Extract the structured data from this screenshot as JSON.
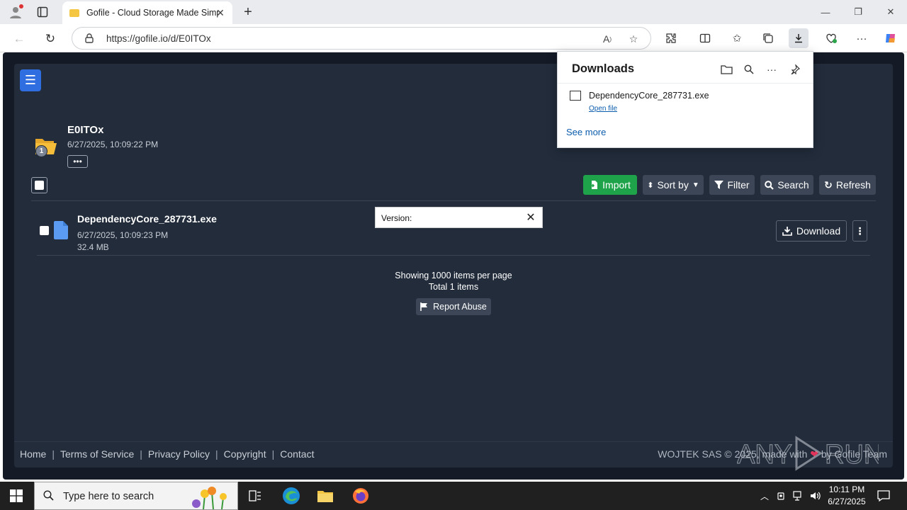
{
  "browser": {
    "tab_title": "Gofile - Cloud Storage Made Simple",
    "url": "https://gofile.io/d/E0ITOx"
  },
  "page": {
    "folder": {
      "name": "E0ITOx",
      "date": "6/27/2025, 10:09:22 PM",
      "badge_count": "1",
      "more_label": "•••"
    },
    "toolbar": {
      "import": "Import",
      "sort_by": "Sort by",
      "filter": "Filter",
      "search": "Search",
      "refresh": "Refresh"
    },
    "file": {
      "name": "DependencyCore_287731.exe",
      "date": "6/27/2025, 10:09:23 PM",
      "size": "32.4 MB",
      "download_label": "Download"
    },
    "version_popup": {
      "label": "Version:"
    },
    "pager": {
      "per_page": "Showing 1000 items per page",
      "total": "Total 1 items"
    },
    "report_abuse": "Report Abuse",
    "footer": {
      "links": [
        "Home",
        "Terms of Service",
        "Privacy Policy",
        "Copyright",
        "Contact"
      ],
      "copyright_pre": "WOJTEK SAS © 2025, made with",
      "copyright_post": "by Gofile Team"
    }
  },
  "downloads_panel": {
    "title": "Downloads",
    "file_name": "DependencyCore_287731.exe",
    "open_file": "Open file",
    "see_more": "See more"
  },
  "taskbar": {
    "search_placeholder": "Type here to search",
    "time": "10:11 PM",
    "date": "6/27/2025"
  },
  "colors": {
    "page_bg": "#141a26",
    "card_bg": "#222c3b",
    "accent_blue": "#2f6ee0",
    "import_green": "#1fa34a",
    "link_blue": "#0b5cad"
  }
}
